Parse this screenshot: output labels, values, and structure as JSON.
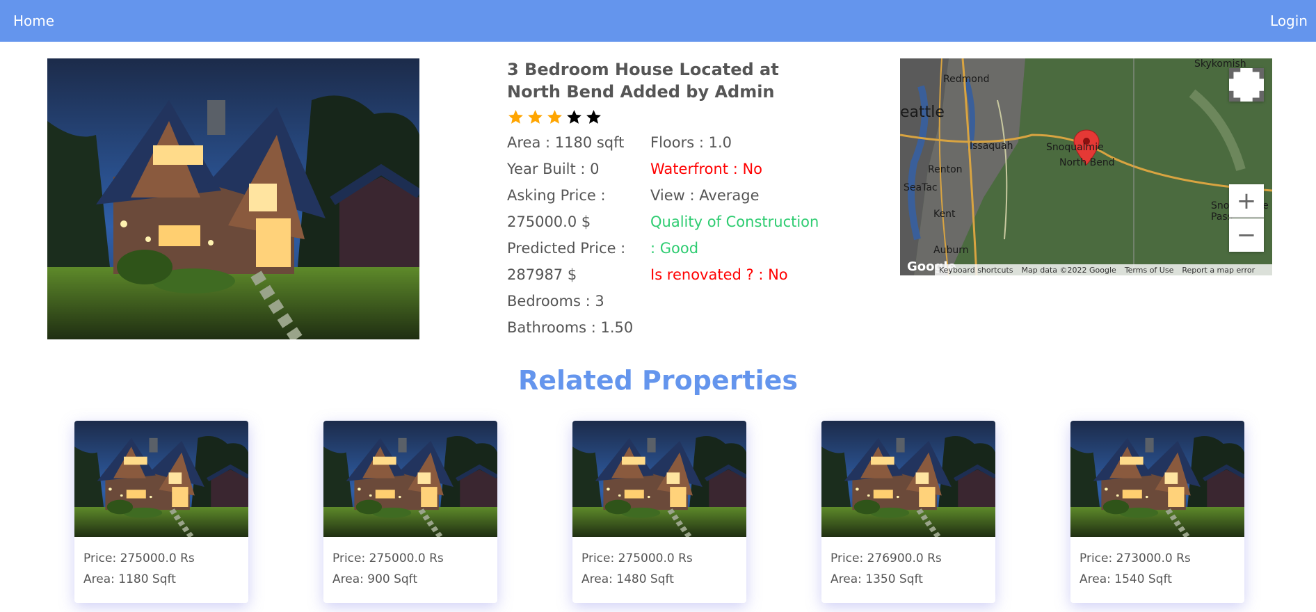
{
  "nav": {
    "home": "Home",
    "login": "Login"
  },
  "property": {
    "title": "3 Bedroom House Located at North Bend Added by Admin",
    "rating": 3,
    "rating_max": 5,
    "left": {
      "area": "Area : 1180 sqft",
      "year_built": "Year Built : 0",
      "asking_price_label": "Asking Price :",
      "asking_price_value": "275000.0 $",
      "predicted_price_label": "Predicted Price :",
      "predicted_price_value": "287987 $",
      "bedrooms": "Bedrooms : 3",
      "bathrooms": "Bathrooms : 1.50"
    },
    "right": {
      "floors": "Floors : 1.0",
      "waterfront": "Waterfront : No",
      "view": "View : Average",
      "quality_line1": "Quality of Construction",
      "quality_line2": ": Good",
      "renovated": "Is renovated ? : No"
    }
  },
  "map": {
    "labels": [
      "Skykomish",
      "Redmond",
      "eattle",
      "Issaquah",
      "Snoqualmie",
      "North Bend",
      "Renton",
      "SeaTac",
      "Kent",
      "Auburn",
      "Snoqualmie Pass"
    ],
    "logo": "Google",
    "footer": [
      "Keyboard shortcuts",
      "Map data ©2022 Google",
      "Terms of Use",
      "Report a map error"
    ]
  },
  "related": {
    "title": "Related Properties",
    "cards": [
      {
        "price": "Price: 275000.0 Rs",
        "area": "Area: 1180 Sqft"
      },
      {
        "price": "Price: 275000.0 Rs",
        "area": "Area: 900 Sqft"
      },
      {
        "price": "Price: 275000.0 Rs",
        "area": "Area: 1480 Sqft"
      },
      {
        "price": "Price: 276900.0 Rs",
        "area": "Area: 1350 Sqft"
      },
      {
        "price": "Price: 273000.0 Rs",
        "area": "Area: 1540 Sqft"
      }
    ]
  },
  "colors": {
    "nav": "#6495ed",
    "star_on": "#ffa500",
    "star_off": "#000000",
    "alert": "#ff0000",
    "good": "#2ecc71"
  }
}
